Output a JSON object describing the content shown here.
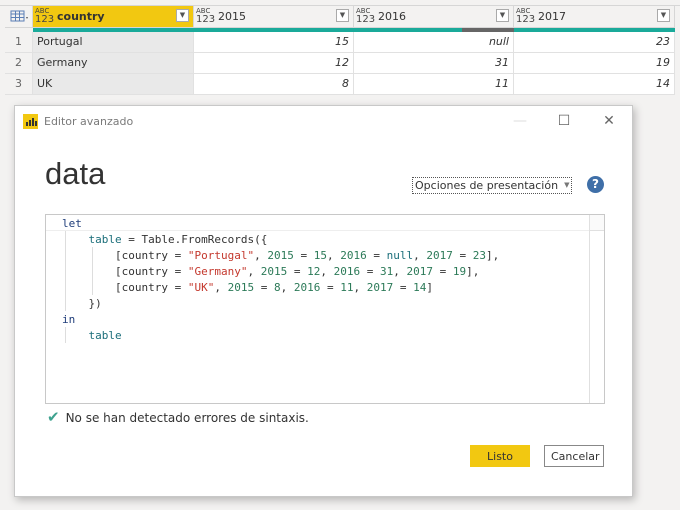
{
  "table": {
    "columns": [
      {
        "name": "country",
        "type": "ABC 123",
        "selected": true
      },
      {
        "name": "2015",
        "type": "ABC 123"
      },
      {
        "name": "2016",
        "type": "ABC 123"
      },
      {
        "name": "2017",
        "type": "ABC 123"
      }
    ],
    "rows": [
      {
        "n": "1",
        "country": "Portugal",
        "c2015": "15",
        "c2016": "null",
        "c2017": "23"
      },
      {
        "n": "2",
        "country": "Germany",
        "c2015": "12",
        "c2016": "31",
        "c2017": "19"
      },
      {
        "n": "3",
        "country": "UK",
        "c2015": "8",
        "c2016": "11",
        "c2017": "14"
      }
    ],
    "dropdown_glyph": "▼",
    "accent": "#f2c811",
    "quality_color": "#1aaa9a"
  },
  "dialog": {
    "title": "Editor avanzado",
    "query_name": "data",
    "display_options": "Opciones de presentación",
    "help_glyph": "?",
    "minimize_glyph": "—",
    "maximize_glyph": "☐",
    "close_glyph": "✕",
    "status_icon": "✔",
    "status": "No se han detectado errores de sintaxis.",
    "ok_label": "Listo",
    "cancel_label": "Cancelar"
  },
  "code": {
    "l1_kw": "let",
    "l2_id": "table",
    "l2_rest": " = Table.FromRecords({",
    "rec1": {
      "pre": "[country = ",
      "str": "\"Portugal\"",
      "a": "2015",
      "av": "15",
      "b": "2016",
      "bv": "null",
      "c": "2017",
      "cv": "23",
      "end": "],"
    },
    "rec2": {
      "pre": "[country = ",
      "str": "\"Germany\"",
      "a": "2015",
      "av": "12",
      "b": "2016",
      "bv": "31",
      "c": "2017",
      "cv": "19",
      "end": "],"
    },
    "rec3": {
      "pre": "[country = ",
      "str": "\"UK\"",
      "a": "2015",
      "av": "8",
      "b": "2016",
      "bv": "11",
      "c": "2017",
      "cv": "14",
      "end": "]"
    },
    "l6": "})",
    "l7_kw": "in",
    "l8_id": "table"
  }
}
